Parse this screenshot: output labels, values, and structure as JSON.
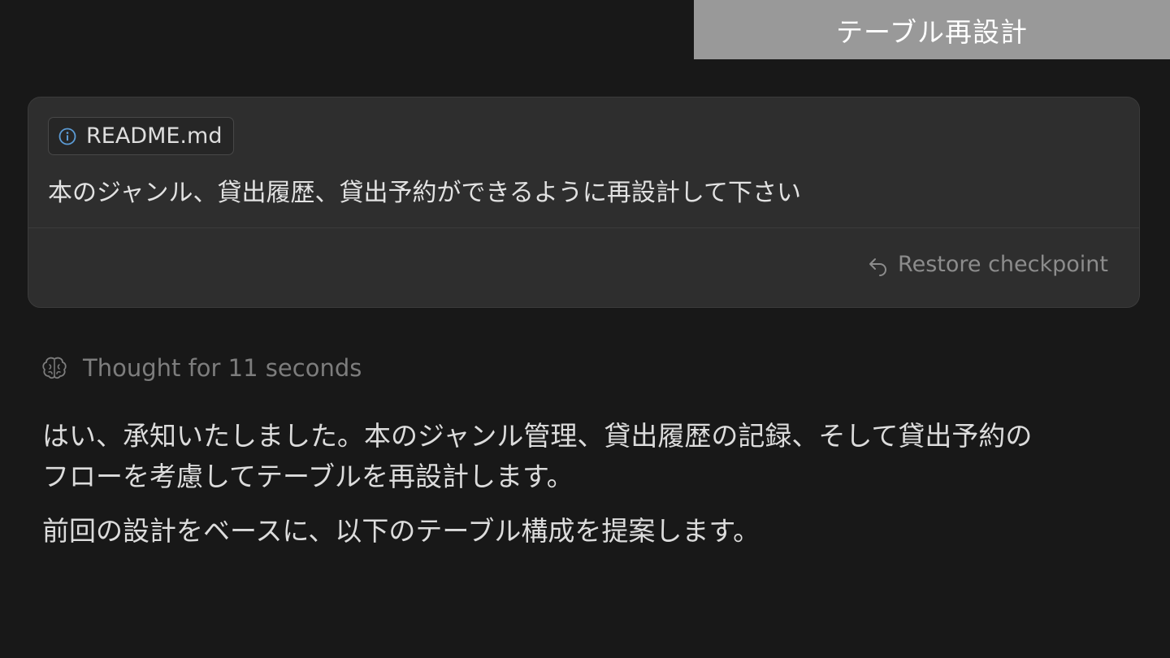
{
  "title_label": "テーブル再設計",
  "message": {
    "context_chip": {
      "icon": "info-icon",
      "label": "README.md"
    },
    "prompt": "本のジャンル、貸出履歴、貸出予約ができるように再設計して下さい",
    "restore": {
      "icon": "undo-arrow-icon",
      "label": "Restore checkpoint"
    }
  },
  "thought": {
    "icon": "brain-icon",
    "label": "Thought for 11 seconds"
  },
  "response": {
    "paragraphs": [
      {
        "line1": "はい、承知いたしました。本のジャンル管理、貸出履歴の記録、そして貸出予約の",
        "line2": "フローを考慮してテーブルを再設計します。"
      },
      {
        "line1": "前回の設計をベースに、以下のテーブル構成を提案します。"
      }
    ]
  },
  "colors": {
    "background": "#181818",
    "card": "#2e2e2e",
    "title_label_bg": "#999999",
    "info_icon": "#5b9bd5",
    "muted_text": "#8c8c8c"
  }
}
